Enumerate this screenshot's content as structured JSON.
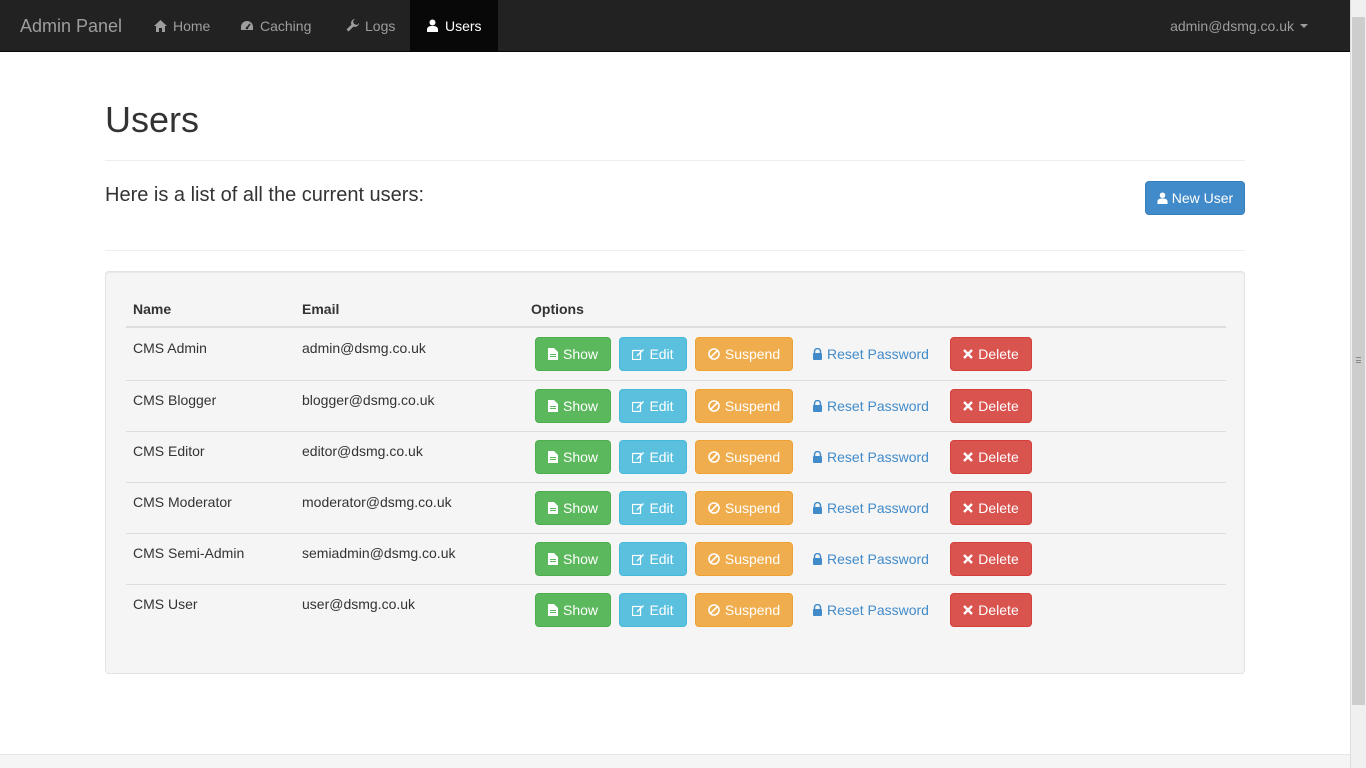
{
  "navbar": {
    "brand": "Admin Panel",
    "items": [
      {
        "label": "Home",
        "icon": "home-icon"
      },
      {
        "label": "Caching",
        "icon": "dashboard-icon"
      },
      {
        "label": "Logs",
        "icon": "wrench-icon"
      },
      {
        "label": "Users",
        "icon": "user-icon",
        "active": true
      }
    ],
    "user_email": "admin@dsmg.co.uk"
  },
  "page": {
    "title": "Users",
    "intro": "Here is a list of all the current users:",
    "new_user_label": "New User"
  },
  "table": {
    "headers": {
      "name": "Name",
      "email": "Email",
      "options": "Options"
    },
    "actions": {
      "show": "Show",
      "edit": "Edit",
      "suspend": "Suspend",
      "reset": "Reset Password",
      "delete": "Delete"
    },
    "rows": [
      {
        "name": "CMS Admin",
        "email": "admin@dsmg.co.uk"
      },
      {
        "name": "CMS Blogger",
        "email": "blogger@dsmg.co.uk"
      },
      {
        "name": "CMS Editor",
        "email": "editor@dsmg.co.uk"
      },
      {
        "name": "CMS Moderator",
        "email": "moderator@dsmg.co.uk"
      },
      {
        "name": "CMS Semi-Admin",
        "email": "semiadmin@dsmg.co.uk"
      },
      {
        "name": "CMS User",
        "email": "user@dsmg.co.uk"
      }
    ]
  },
  "colors": {
    "navbar": "#222222",
    "primary": "#428bca",
    "success": "#5cb85c",
    "info": "#5bc0de",
    "warning": "#f0ad4e",
    "danger": "#d9534f"
  }
}
